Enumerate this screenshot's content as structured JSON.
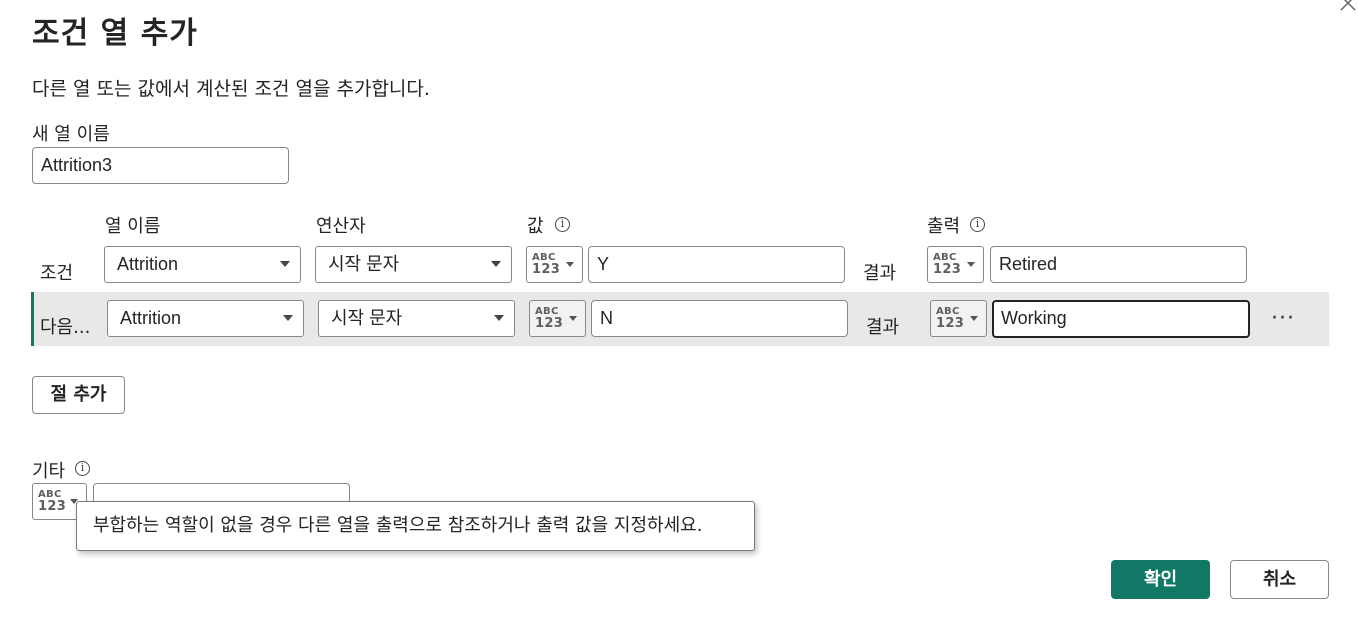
{
  "dialog": {
    "title": "조건 열 추가",
    "description": "다른 열 또는 값에서 계산된 조건 열을 추가합니다.",
    "close_icon": "close-icon"
  },
  "new_column": {
    "label": "새 열 이름",
    "value": "Attrition3"
  },
  "headers": {
    "column_name": "열 이름",
    "operator": "연산자",
    "value": "값",
    "output": "출력"
  },
  "type_icon_text": {
    "abc": "ABC",
    "num": "123"
  },
  "clauses": [
    {
      "label": "조건",
      "column": "Attrition",
      "operator": "시작 문자",
      "value": "Y",
      "result_label": "결과",
      "output": "Retired"
    },
    {
      "label": "다음...",
      "column": "Attrition",
      "operator": "시작 문자",
      "value": "N",
      "result_label": "결과",
      "output": "Working",
      "more": "···"
    }
  ],
  "add_clause_button": "절 추가",
  "else": {
    "label": "기타",
    "value": ""
  },
  "tooltip": "부합하는 역할이 없을 경우 다른 열을 출력으로 참조하거나 출력 값을 지정하세요.",
  "footer": {
    "ok": "확인",
    "cancel": "취소"
  },
  "colors": {
    "accent": "#117865",
    "row_highlight": "#e8e8e8"
  }
}
